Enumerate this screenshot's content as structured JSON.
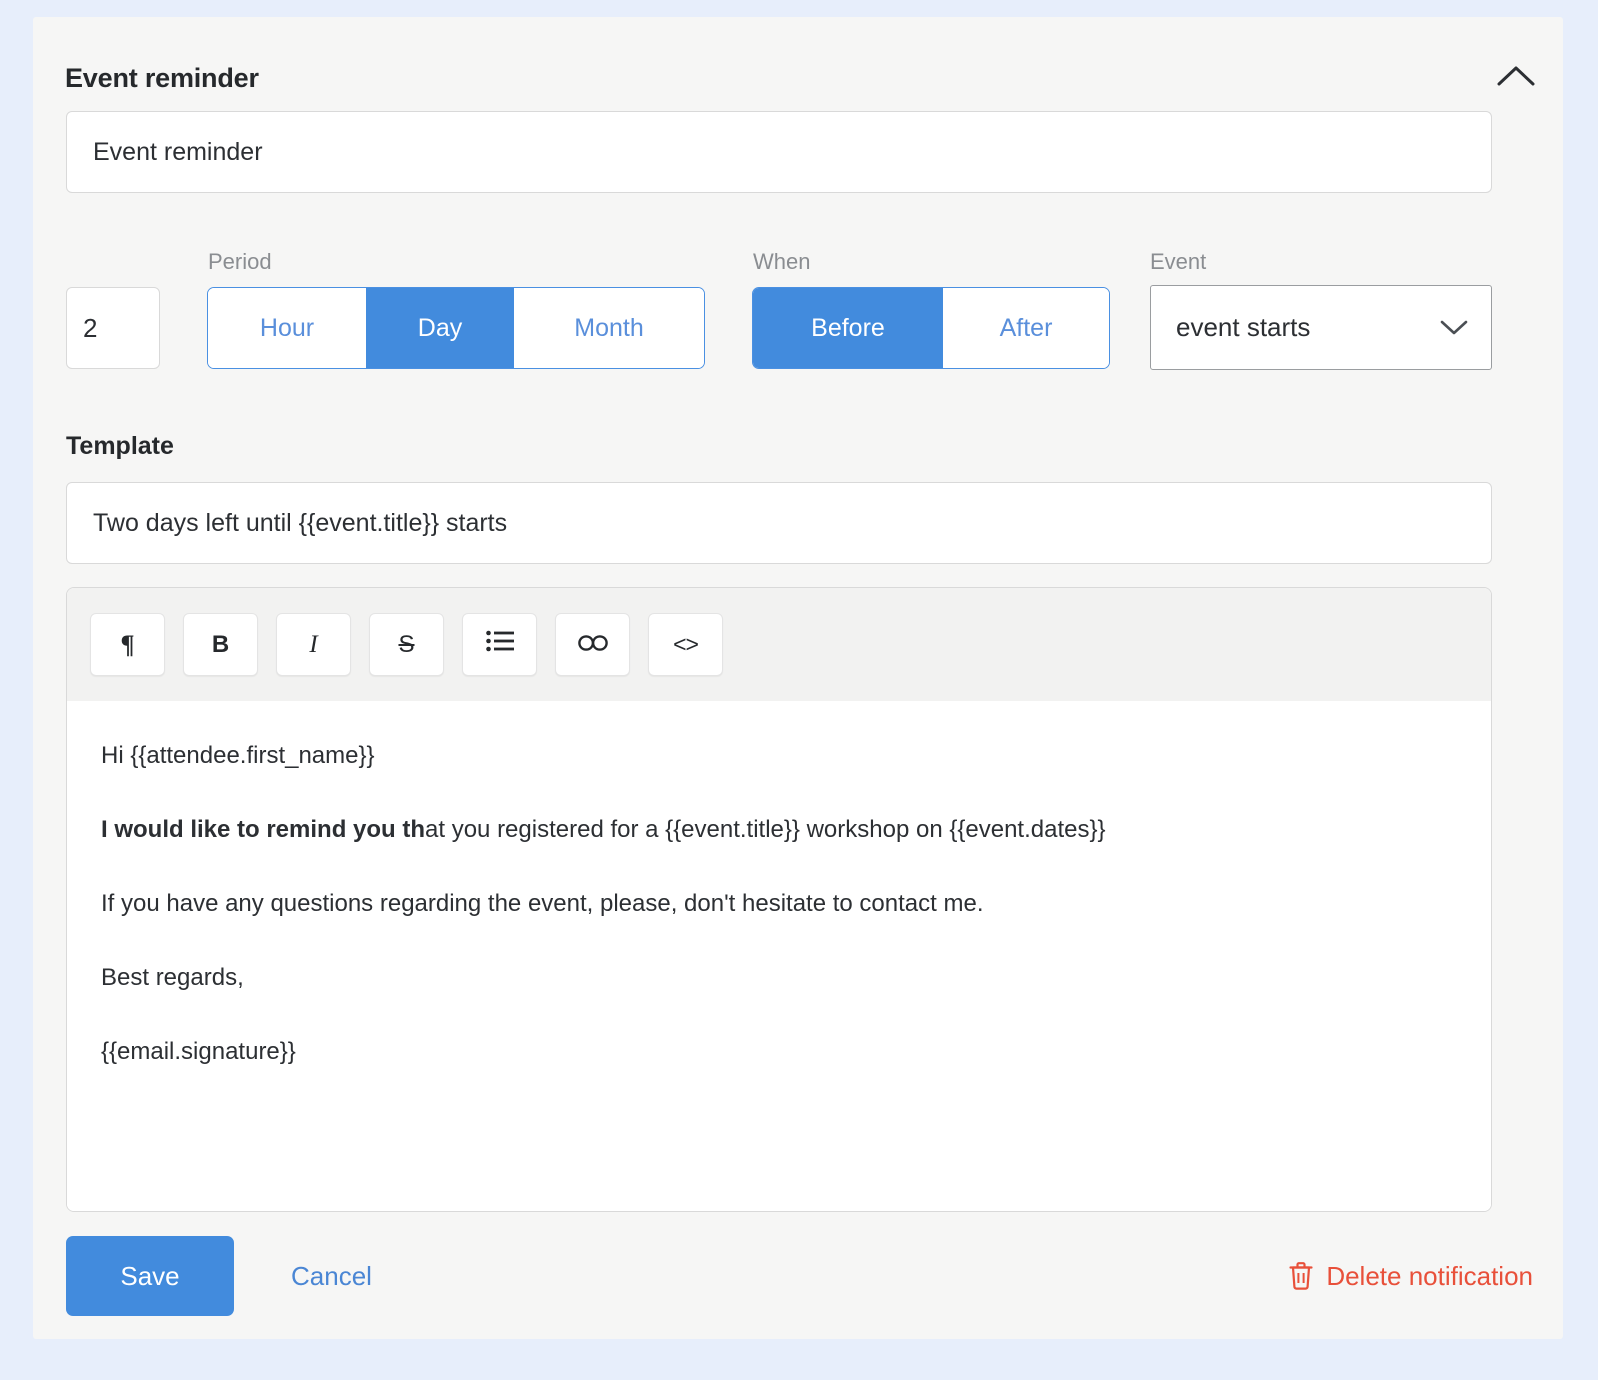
{
  "card": {
    "title": "Event reminder",
    "collapse_icon": "chevron-up-icon",
    "name_input": {
      "value": "Event reminder",
      "placeholder": "Notification name"
    }
  },
  "schedule": {
    "amount": {
      "value": "2",
      "placeholder": ""
    },
    "period": {
      "label": "Period",
      "options": [
        "Hour",
        "Day",
        "Month"
      ],
      "selected": "Day"
    },
    "when": {
      "label": "When",
      "options": [
        "Before",
        "After"
      ],
      "selected": "Before"
    },
    "event": {
      "label": "Event",
      "selected": "event starts",
      "chevron_icon": "chevron-down-icon"
    }
  },
  "template": {
    "section_title": "Template",
    "subject": {
      "value": "Two days left until {{event.title}} starts",
      "placeholder": "Subject"
    },
    "toolbar": [
      {
        "name": "paragraph-icon",
        "glyph": "¶",
        "title": "Paragraph"
      },
      {
        "name": "bold-icon",
        "glyph": "B",
        "title": "Bold"
      },
      {
        "name": "italic-icon",
        "glyph": "I",
        "title": "Italic"
      },
      {
        "name": "strikethrough-icon",
        "glyph": "S",
        "title": "Strikethrough"
      },
      {
        "name": "bullet-list-icon",
        "glyph": "",
        "title": "Bullet list"
      },
      {
        "name": "link-icon",
        "glyph": "",
        "title": "Insert link"
      },
      {
        "name": "code-icon",
        "glyph": "<>",
        "title": "Code"
      }
    ],
    "body": {
      "line1": "Hi {{attendee.first_name}}",
      "line2_bold": "I would like to remind you th",
      "line2_rest": "at you registered for a {{event.title}} workshop on {{event.dates}}",
      "line3": "If you have any questions regarding the event, please, don't hesitate to contact me.",
      "line4": "Best regards,",
      "line5": "{{email.signature}}"
    }
  },
  "footer": {
    "save_label": "Save",
    "cancel_label": "Cancel",
    "delete_label": "Delete notification",
    "delete_icon": "trash-icon"
  },
  "colors": {
    "page_background": "#e7eefb",
    "card_background": "#f6f6f5",
    "accent_blue": "#428bdd",
    "link_blue": "#4a86d4",
    "danger_red": "#e8503a",
    "label_gray": "#8a8d91",
    "text_dark": "#2c2f33"
  }
}
